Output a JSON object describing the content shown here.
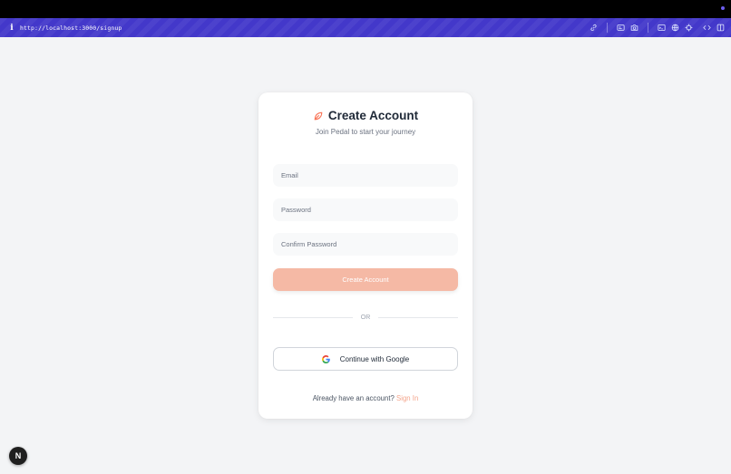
{
  "browser": {
    "url": "http://localhost:3000/signup",
    "info_icon": "i",
    "toolbar_icons": [
      "link-icon",
      "id-card-icon",
      "camera-icon",
      "terminal-icon",
      "globe-icon",
      "crosshair-icon",
      "code-icon",
      "split-panel-icon"
    ]
  },
  "signup": {
    "title": "Create Account",
    "subtitle": "Join Pedal to start your journey",
    "email_placeholder": "Email",
    "password_placeholder": "Password",
    "confirm_placeholder": "Confirm Password",
    "submit_label": "Create Account",
    "divider_text": "OR",
    "google_label": "Continue with Google",
    "footer_text": "Already have an account?",
    "signin_label": "Sign In"
  },
  "nextjs_badge": {
    "label": "N"
  },
  "colors": {
    "accent": "#f97356",
    "accent_light": "#f5b9a5",
    "link": "#f4a58c",
    "address_bar": "#4338ca"
  }
}
